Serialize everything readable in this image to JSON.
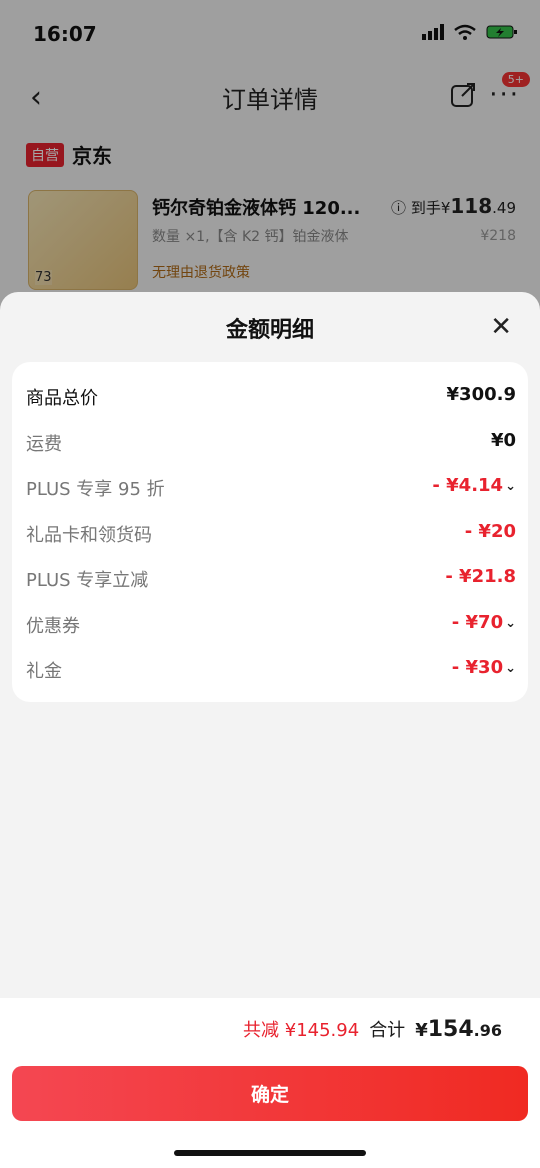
{
  "status": {
    "time": "16:07"
  },
  "nav": {
    "title": "订单详情",
    "badge": "5+"
  },
  "store": {
    "tag": "自营",
    "name": "京东"
  },
  "product": {
    "name": "钙尔奇铂金液体钙 120...",
    "spec": "数量 ×1,【含 K2 钙】铂金液体",
    "policy": "无理由退货政策",
    "price_label": "到手¥",
    "price_int": "118",
    "price_dec": ".49",
    "original_price": "¥218",
    "thumb_text": "73"
  },
  "sheet": {
    "title": "金额明细",
    "rows": [
      {
        "label": "商品总价",
        "value": "¥300.9"
      },
      {
        "label": "运费",
        "value": "¥0"
      },
      {
        "label": "PLUS 专享 95 折",
        "value": "- ¥4.14"
      },
      {
        "label": "礼品卡和领货码",
        "value": "- ¥20"
      },
      {
        "label": "PLUS 专享立减",
        "value": "- ¥21.8"
      },
      {
        "label": "优惠券",
        "value": "- ¥70"
      },
      {
        "label": "礼金",
        "value": "- ¥30"
      }
    ]
  },
  "footer": {
    "saved": "共减 ¥145.94",
    "total_label": "合计",
    "total_currency": "¥",
    "total_int": "154",
    "total_dec": ".96"
  },
  "confirm_label": "确定",
  "colors": {
    "accent": "#e8222e",
    "button_start": "#f44752",
    "button_end": "#f02a22"
  }
}
